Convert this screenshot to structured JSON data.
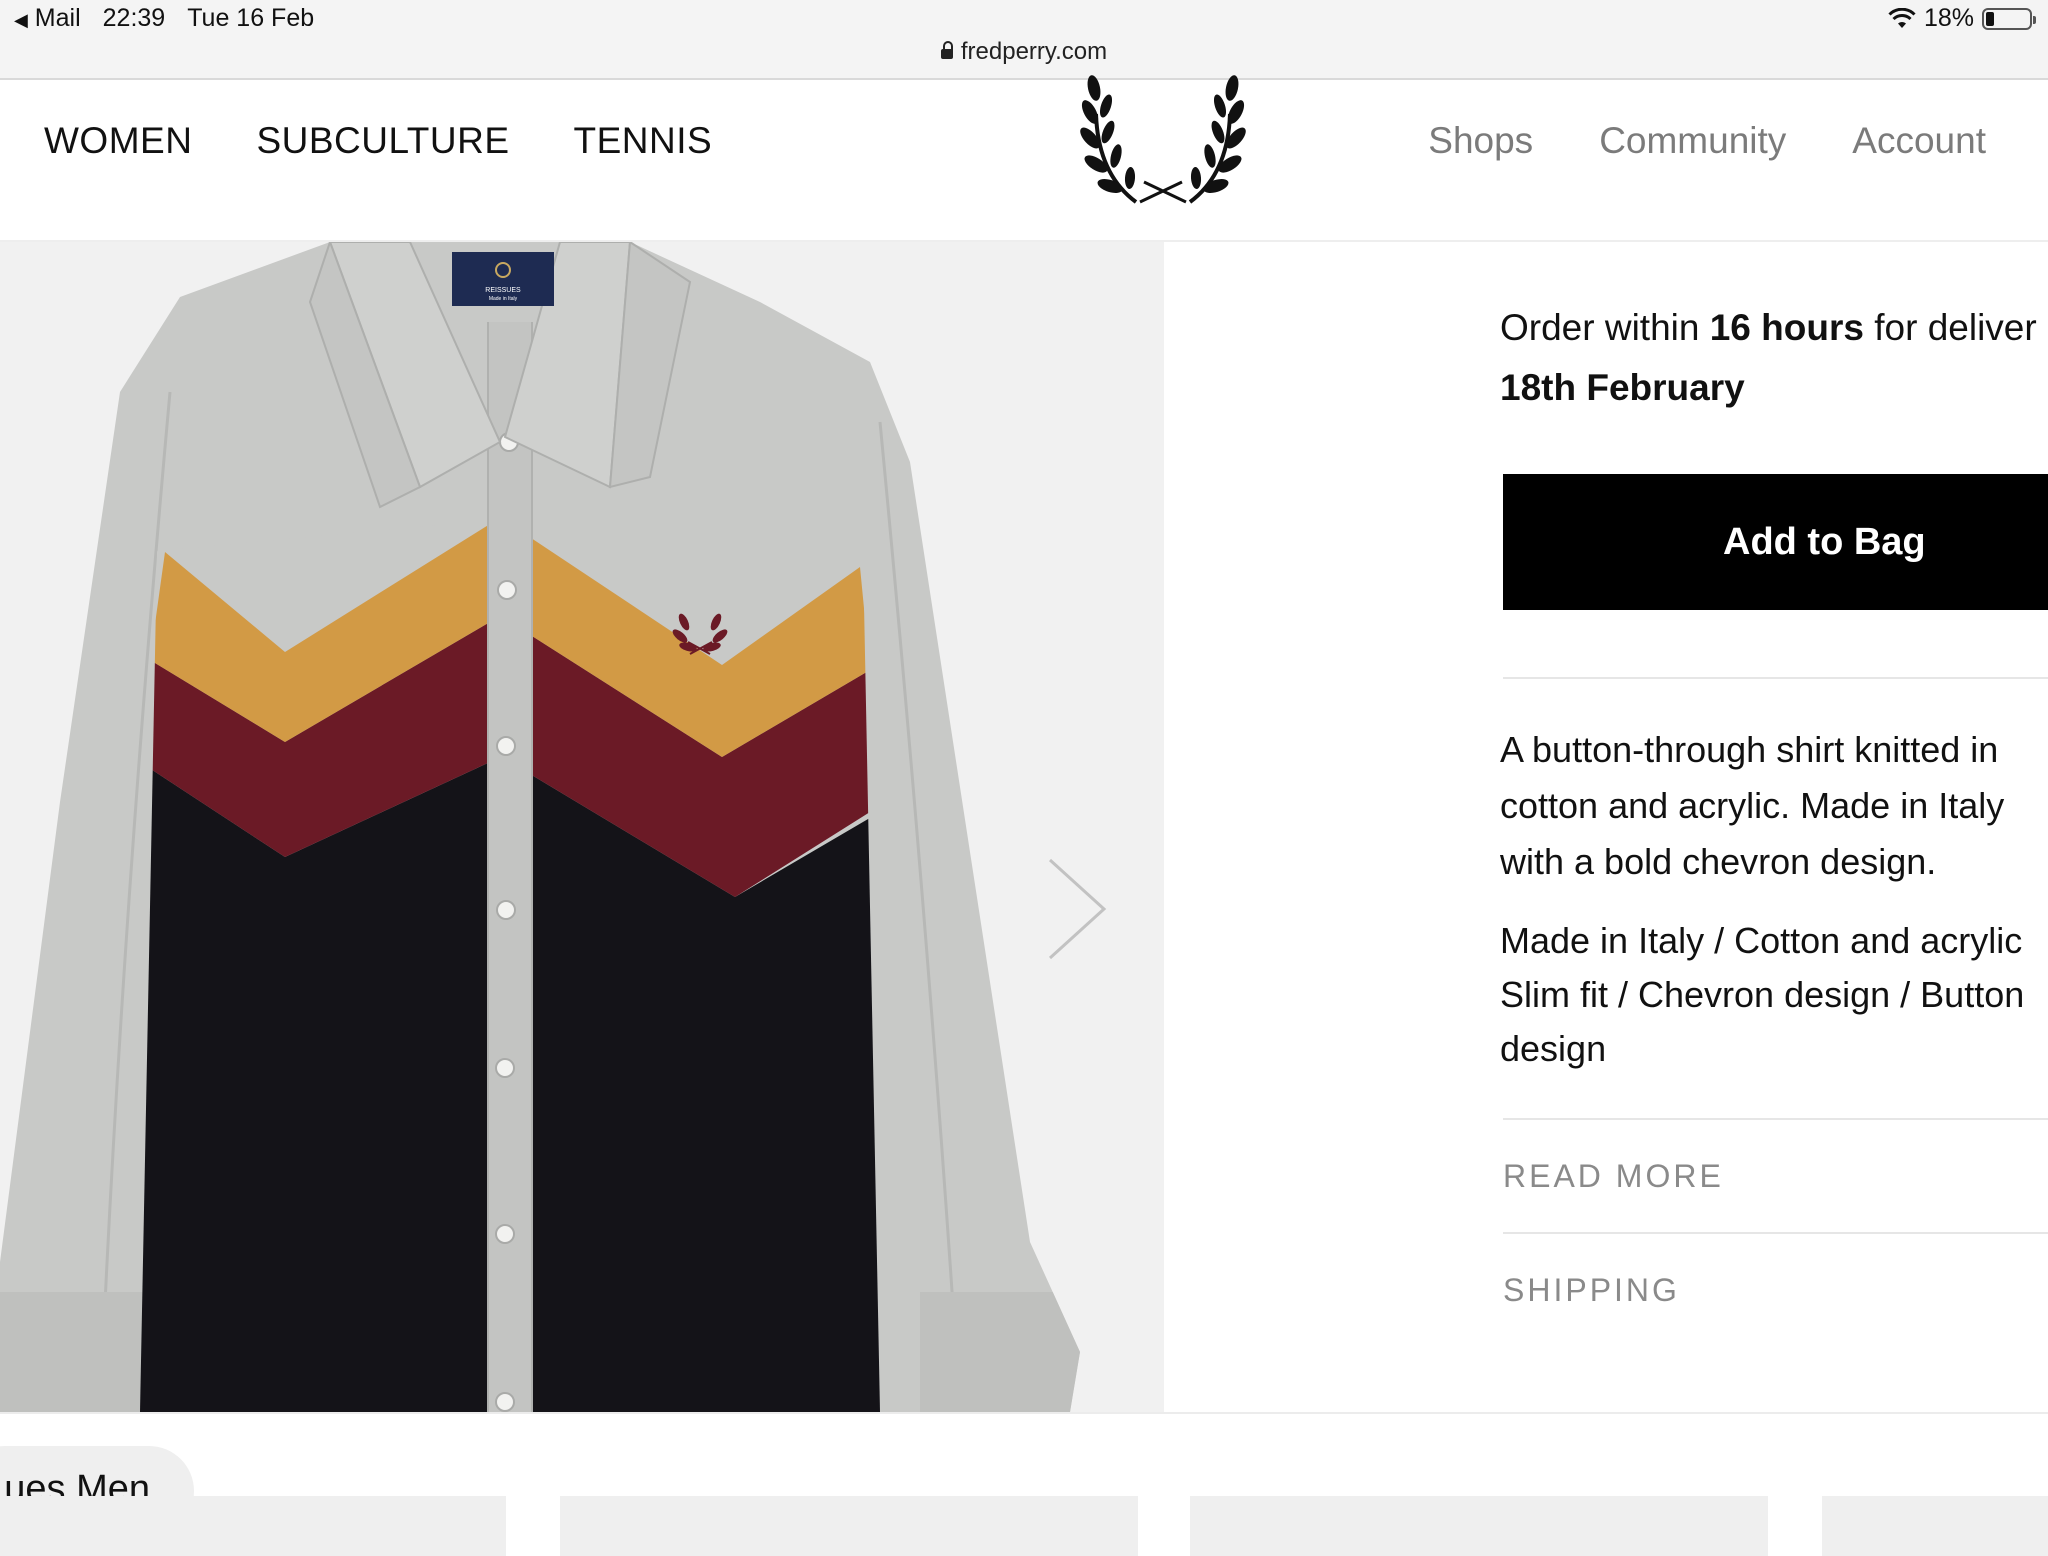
{
  "status_bar": {
    "back_app": "Mail",
    "time": "22:39",
    "date": "Tue 16 Feb",
    "battery": "18%",
    "battery_level": 0.18,
    "url": "fredperry.com"
  },
  "header": {
    "nav_left": [
      "WOMEN",
      "SUBCULTURE",
      "TENNIS"
    ],
    "nav_right": [
      "Shops",
      "Community",
      "Account"
    ],
    "logo_icon": "laurel-wreath-logo"
  },
  "product_image": {
    "label_lines": [
      "REISSUES",
      "Made in Italy"
    ],
    "colors": {
      "background": "#f1f1f1",
      "body_grey": "#c8c9c7",
      "mustard": "#d29a45",
      "burgundy": "#6b1a26",
      "black": "#141318"
    }
  },
  "delivery": {
    "prefix": "Order within ",
    "hours": "16 hours",
    "suffix": " for deliver",
    "date": "18th February"
  },
  "buttons": {
    "add_to_bag": "Add to Bag"
  },
  "description": {
    "lines": [
      "A button-through shirt knitted in",
      "cotton and acrylic. Made in Italy",
      "with a bold chevron design."
    ]
  },
  "features": {
    "lines": [
      "Made in Italy / Cotton and acrylic",
      "Slim fit / Chevron design / Button",
      "design"
    ]
  },
  "accordion": {
    "read_more": "READ MORE",
    "shipping": "SHIPPING"
  },
  "bottom": {
    "chip_label": "ues Men"
  }
}
